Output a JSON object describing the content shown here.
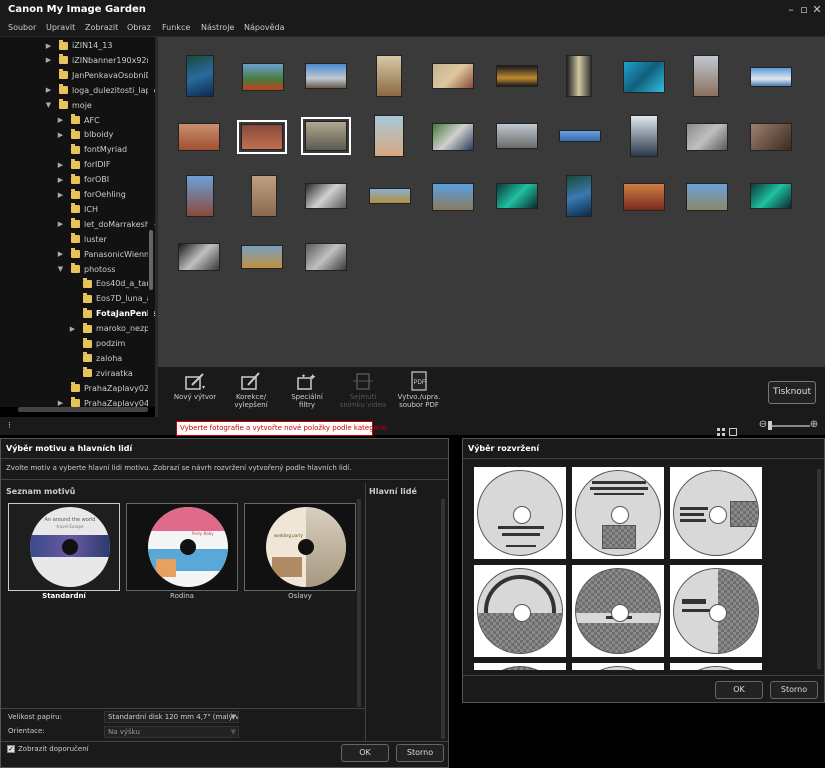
{
  "app": {
    "title": "Canon My Image Garden"
  },
  "menu": [
    "Soubor",
    "Upravit",
    "Zobrazit",
    "Obraz",
    "Funkce",
    "Nástroje",
    "Nápověda"
  ],
  "tree": [
    {
      "label": "iZIN14_13",
      "level": 0,
      "arrow": "▶"
    },
    {
      "label": "iZINbanner190x92mm",
      "level": 0,
      "arrow": "▶"
    },
    {
      "label": "JanPenkavaOsobniD",
      "level": 0,
      "arrow": ""
    },
    {
      "label": "loga_dulezitosti_laptop",
      "level": 0,
      "arrow": "▶"
    },
    {
      "label": "moje",
      "level": 0,
      "arrow": "▼"
    },
    {
      "label": "AFC",
      "level": 1,
      "arrow": "▶"
    },
    {
      "label": "blboidy",
      "level": 1,
      "arrow": "▶"
    },
    {
      "label": "fontMyriad",
      "level": 1,
      "arrow": ""
    },
    {
      "label": "forIDIF",
      "level": 1,
      "arrow": "▶"
    },
    {
      "label": "forOBI",
      "level": 1,
      "arrow": "▶"
    },
    {
      "label": "forOehling",
      "level": 1,
      "arrow": "▶"
    },
    {
      "label": "ICH",
      "level": 1,
      "arrow": ""
    },
    {
      "label": "let_doMarrakeshe",
      "level": 1,
      "arrow": "▶"
    },
    {
      "label": "luster",
      "level": 1,
      "arrow": ""
    },
    {
      "label": "PanasonicWienna",
      "level": 1,
      "arrow": "▶"
    },
    {
      "label": "photoss",
      "level": 1,
      "arrow": "▼"
    },
    {
      "label": "Eos40d_a_tam",
      "level": 2,
      "arrow": ""
    },
    {
      "label": "Eos7D_luna_a",
      "level": 2,
      "arrow": ""
    },
    {
      "label": "FotaJanPenka",
      "level": 2,
      "arrow": "",
      "selected": true
    },
    {
      "label": "maroko_nezpr",
      "level": 2,
      "arrow": "▶"
    },
    {
      "label": "podzim",
      "level": 2,
      "arrow": ""
    },
    {
      "label": "zaloha",
      "level": 2,
      "arrow": ""
    },
    {
      "label": "zviraatka",
      "level": 2,
      "arrow": ""
    },
    {
      "label": "PrahaZaplavy02_",
      "level": 1,
      "arrow": ""
    },
    {
      "label": "PrahaZaplavy04",
      "level": 1,
      "arrow": "▶"
    }
  ],
  "toolbar": {
    "new_label": "Nový výtvor",
    "correct_label": "Korekce/\nvylepšení",
    "filters_label": "Speciální\nfiltry",
    "video_label": "Sejmutí\nsnímku videa",
    "pdf_label": "Vytvo./upra.\nsoubor PDF",
    "print_label": "Tisknout"
  },
  "tooltip": "Vyberte fotografie a vytvořte nové položky podle kategorie.",
  "colors": {
    "accent_red": "#cc0000",
    "folder": "#e8c25a"
  },
  "theme_dialog": {
    "title": "Výběr motivu a hlavních lidí",
    "description": "Zvolte motiv a vyberte hlavní lidi motivu. Zobrazí se návrh rozvržení vytvořený podle hlavních lidí.",
    "list_header": "Seznam motivů",
    "people_header": "Hlavní lidé",
    "themes": [
      {
        "name": "Standardní",
        "disc_title": "An around the world",
        "disc_sub": "travel Europe",
        "selected": true
      },
      {
        "name": "Rodina",
        "disc_title": "Party Baby",
        "selected": false
      },
      {
        "name": "Oslavy",
        "disc_title": "wedding party",
        "selected": false
      }
    ],
    "paper_label": "Velikost papíru:",
    "paper_value": "Standardní disk 120 mm 4,7\" (malý v",
    "orient_label": "Orientace:",
    "orient_value": "Na výšku",
    "recommend_label": "Zobrazit doporučení",
    "ok_label": "OK",
    "cancel_label": "Storno"
  },
  "layout_dialog": {
    "title": "Výběr rozvržení",
    "ok_label": "OK",
    "cancel_label": "Storno"
  }
}
